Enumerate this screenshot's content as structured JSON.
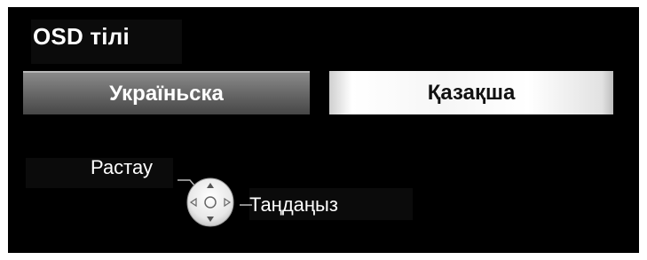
{
  "title": "OSD тілі",
  "options": [
    {
      "label": "Україньска",
      "selected": false
    },
    {
      "label": "Қазақша",
      "selected": true
    }
  ],
  "hints": {
    "confirm": "Растау",
    "select": "Таңдаңыз"
  },
  "colors": {
    "background": "#000000",
    "option_inactive": "#6b6b6b",
    "option_active": "#ffffff"
  },
  "icons": {
    "dpad": "remote-dpad-icon"
  }
}
